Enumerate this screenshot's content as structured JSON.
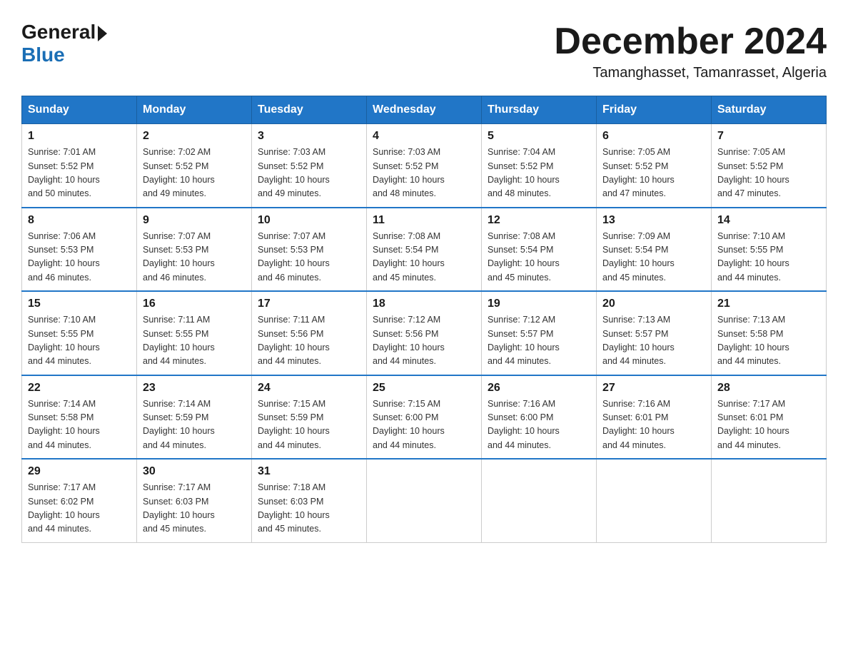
{
  "logo": {
    "general": "General",
    "blue": "Blue"
  },
  "title": "December 2024",
  "location": "Tamanghasset, Tamanrasset, Algeria",
  "days_header": [
    "Sunday",
    "Monday",
    "Tuesday",
    "Wednesday",
    "Thursday",
    "Friday",
    "Saturday"
  ],
  "weeks": [
    [
      {
        "day": "1",
        "sunrise": "7:01 AM",
        "sunset": "5:52 PM",
        "daylight": "10 hours and 50 minutes."
      },
      {
        "day": "2",
        "sunrise": "7:02 AM",
        "sunset": "5:52 PM",
        "daylight": "10 hours and 49 minutes."
      },
      {
        "day": "3",
        "sunrise": "7:03 AM",
        "sunset": "5:52 PM",
        "daylight": "10 hours and 49 minutes."
      },
      {
        "day": "4",
        "sunrise": "7:03 AM",
        "sunset": "5:52 PM",
        "daylight": "10 hours and 48 minutes."
      },
      {
        "day": "5",
        "sunrise": "7:04 AM",
        "sunset": "5:52 PM",
        "daylight": "10 hours and 48 minutes."
      },
      {
        "day": "6",
        "sunrise": "7:05 AM",
        "sunset": "5:52 PM",
        "daylight": "10 hours and 47 minutes."
      },
      {
        "day": "7",
        "sunrise": "7:05 AM",
        "sunset": "5:52 PM",
        "daylight": "10 hours and 47 minutes."
      }
    ],
    [
      {
        "day": "8",
        "sunrise": "7:06 AM",
        "sunset": "5:53 PM",
        "daylight": "10 hours and 46 minutes."
      },
      {
        "day": "9",
        "sunrise": "7:07 AM",
        "sunset": "5:53 PM",
        "daylight": "10 hours and 46 minutes."
      },
      {
        "day": "10",
        "sunrise": "7:07 AM",
        "sunset": "5:53 PM",
        "daylight": "10 hours and 46 minutes."
      },
      {
        "day": "11",
        "sunrise": "7:08 AM",
        "sunset": "5:54 PM",
        "daylight": "10 hours and 45 minutes."
      },
      {
        "day": "12",
        "sunrise": "7:08 AM",
        "sunset": "5:54 PM",
        "daylight": "10 hours and 45 minutes."
      },
      {
        "day": "13",
        "sunrise": "7:09 AM",
        "sunset": "5:54 PM",
        "daylight": "10 hours and 45 minutes."
      },
      {
        "day": "14",
        "sunrise": "7:10 AM",
        "sunset": "5:55 PM",
        "daylight": "10 hours and 44 minutes."
      }
    ],
    [
      {
        "day": "15",
        "sunrise": "7:10 AM",
        "sunset": "5:55 PM",
        "daylight": "10 hours and 44 minutes."
      },
      {
        "day": "16",
        "sunrise": "7:11 AM",
        "sunset": "5:55 PM",
        "daylight": "10 hours and 44 minutes."
      },
      {
        "day": "17",
        "sunrise": "7:11 AM",
        "sunset": "5:56 PM",
        "daylight": "10 hours and 44 minutes."
      },
      {
        "day": "18",
        "sunrise": "7:12 AM",
        "sunset": "5:56 PM",
        "daylight": "10 hours and 44 minutes."
      },
      {
        "day": "19",
        "sunrise": "7:12 AM",
        "sunset": "5:57 PM",
        "daylight": "10 hours and 44 minutes."
      },
      {
        "day": "20",
        "sunrise": "7:13 AM",
        "sunset": "5:57 PM",
        "daylight": "10 hours and 44 minutes."
      },
      {
        "day": "21",
        "sunrise": "7:13 AM",
        "sunset": "5:58 PM",
        "daylight": "10 hours and 44 minutes."
      }
    ],
    [
      {
        "day": "22",
        "sunrise": "7:14 AM",
        "sunset": "5:58 PM",
        "daylight": "10 hours and 44 minutes."
      },
      {
        "day": "23",
        "sunrise": "7:14 AM",
        "sunset": "5:59 PM",
        "daylight": "10 hours and 44 minutes."
      },
      {
        "day": "24",
        "sunrise": "7:15 AM",
        "sunset": "5:59 PM",
        "daylight": "10 hours and 44 minutes."
      },
      {
        "day": "25",
        "sunrise": "7:15 AM",
        "sunset": "6:00 PM",
        "daylight": "10 hours and 44 minutes."
      },
      {
        "day": "26",
        "sunrise": "7:16 AM",
        "sunset": "6:00 PM",
        "daylight": "10 hours and 44 minutes."
      },
      {
        "day": "27",
        "sunrise": "7:16 AM",
        "sunset": "6:01 PM",
        "daylight": "10 hours and 44 minutes."
      },
      {
        "day": "28",
        "sunrise": "7:17 AM",
        "sunset": "6:01 PM",
        "daylight": "10 hours and 44 minutes."
      }
    ],
    [
      {
        "day": "29",
        "sunrise": "7:17 AM",
        "sunset": "6:02 PM",
        "daylight": "10 hours and 44 minutes."
      },
      {
        "day": "30",
        "sunrise": "7:17 AM",
        "sunset": "6:03 PM",
        "daylight": "10 hours and 45 minutes."
      },
      {
        "day": "31",
        "sunrise": "7:18 AM",
        "sunset": "6:03 PM",
        "daylight": "10 hours and 45 minutes."
      },
      null,
      null,
      null,
      null
    ]
  ],
  "labels": {
    "sunrise": "Sunrise:",
    "sunset": "Sunset:",
    "daylight": "Daylight:"
  }
}
